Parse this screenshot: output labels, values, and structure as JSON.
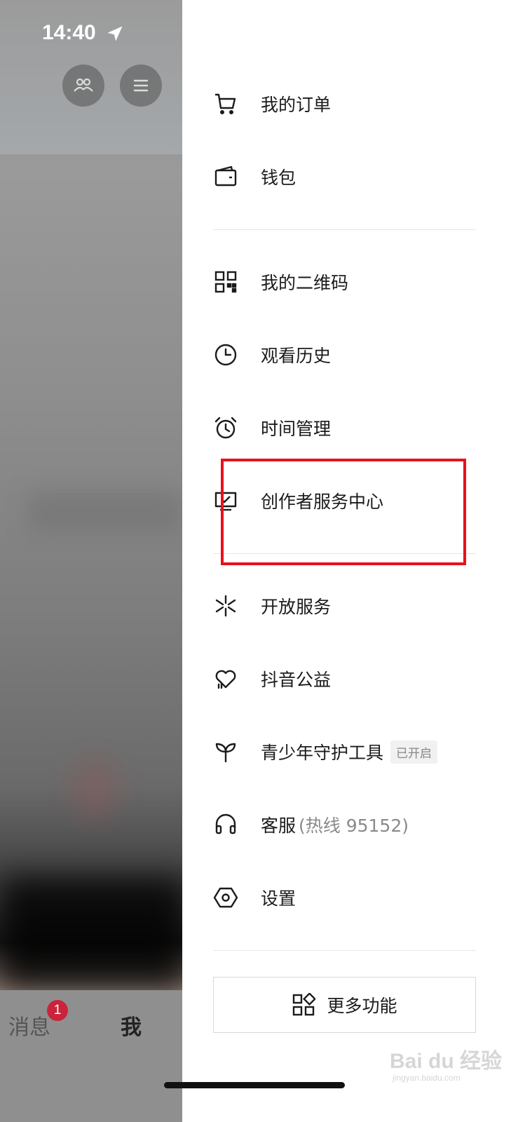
{
  "status_bar": {
    "time": "14:40"
  },
  "tab_bar": {
    "messages_label": "消息",
    "messages_badge": "1",
    "me_label": "我"
  },
  "drawer": {
    "items": [
      {
        "label": "我的订单",
        "icon": "cart-icon"
      },
      {
        "label": "钱包",
        "icon": "wallet-icon"
      },
      {
        "label": "我的二维码",
        "icon": "qrcode-icon"
      },
      {
        "label": "观看历史",
        "icon": "clock-icon"
      },
      {
        "label": "时间管理",
        "icon": "alarm-icon"
      },
      {
        "label": "创作者服务中心",
        "icon": "monitor-check-icon"
      },
      {
        "label": "开放服务",
        "icon": "spark-icon"
      },
      {
        "label": "抖音公益",
        "icon": "heart-hands-icon"
      },
      {
        "label": "青少年守护工具",
        "icon": "sprout-icon",
        "tag": "已开启"
      },
      {
        "label": "客服",
        "icon": "headset-icon",
        "sub": "(热线 95152)"
      },
      {
        "label": "设置",
        "icon": "hexagon-gear-icon"
      }
    ],
    "more_button": {
      "label": "更多功能",
      "icon": "apps-icon"
    }
  },
  "watermark": {
    "text": "Bai du 经验",
    "sub": "jingyan.baidu.com"
  },
  "colors": {
    "highlight": "#e8111c",
    "badge": "#c9243b"
  }
}
